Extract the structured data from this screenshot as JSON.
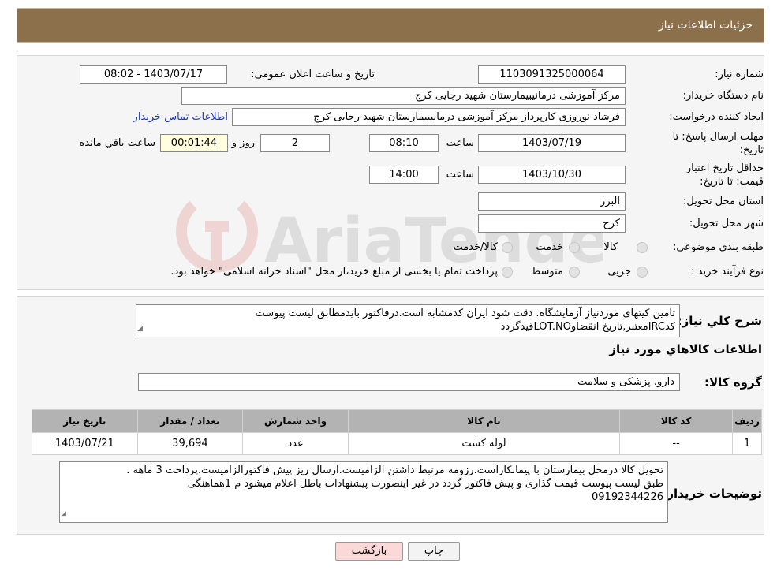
{
  "header": {
    "title": "جزئیات اطلاعات نیاز"
  },
  "form": {
    "need_number_label": "شماره نیاز:",
    "need_number": "1103091325000064",
    "announce_label": "تاریخ و ساعت اعلان عمومی:",
    "announce_value": "1403/07/17 - 08:02",
    "buyer_org_label": "نام دستگاه خریدار:",
    "buyer_org": "مرکز آموزشی درمانیبیمارستان شهید رجایی کرج",
    "creator_label": "ایجاد کننده درخواست:",
    "creator": "فرشاد نوروزی کارپرداز مرکز آموزشی درمانیبیمارستان شهید رجایی کرج",
    "contact_link": "اطلاعات تماس خریدار",
    "deadline_label": "مهلت ارسال پاسخ: تا تاریخ:",
    "deadline_date": "1403/07/19",
    "time_label": "ساعت",
    "deadline_time": "08:10",
    "days_value": "2",
    "days_label": "روز و",
    "remaining_time": "00:01:44",
    "remaining_label": "ساعت باقي مانده",
    "validity_label": "حداقل تاریخ اعتبار قیمت: تا تاریخ:",
    "validity_date": "1403/10/30",
    "validity_time": "14:00",
    "province_label": "استان محل تحویل:",
    "province": "البرز",
    "city_label": "شهر محل تحویل:",
    "city": "کرج",
    "category_label": "طبقه بندی موضوعی:",
    "category_options": [
      "کالا",
      "خدمت",
      "کالا/خدمت"
    ],
    "process_label": "نوع فرآیند خرید :",
    "process_options": [
      "جزیی",
      "متوسط"
    ],
    "payment_note": "پرداخت تمام یا بخشی از مبلغ خرید،از محل \"اسناد خزانه اسلامی\" خواهد بود."
  },
  "watermark_text": "AriaTender.neT",
  "description": {
    "label": "شرح کلي نياز:",
    "text_line1": "تامین کیتهای موردنیاز آزمایشگاه. دقت شود ایران کدمشابه است.درفاکتور بایدمطابق لیست پیوست",
    "text_line2": "کدIRCمعتبر,تاریخ انقضاوLOT.NOقیدگردد"
  },
  "goods": {
    "section_title": "اطلاعات کالاهاي مورد نياز",
    "group_label": "گروه کالا:",
    "group_value": "دارو، پزشکی و سلامت",
    "columns": [
      "ردیف",
      "کد کالا",
      "نام کالا",
      "واحد شمارش",
      "تعداد / مقدار",
      "تاریخ نیاز"
    ],
    "rows": [
      {
        "row": "1",
        "code": "--",
        "name": "لوله کشت",
        "unit": "عدد",
        "qty": "39,694",
        "date": "1403/07/21"
      }
    ]
  },
  "buyer_notes": {
    "label": "توضیحات خریدار:",
    "line1": "تحویل کالا درمحل بیمارستان با پیمانکاراست.رزومه مرتبط داشتن الزامیست.ارسال ریز پیش فاکتورالزامیست.پرداخت 3 ماهه .",
    "line2": "طبق لیست پیوست قیمت گذاری و پیش فاکتور گردد در غیر اینصورت پیشنهادات باطل اعلام میشود م 1هماهنگی",
    "line3": "09192344226"
  },
  "buttons": {
    "print": "چاپ",
    "back": "بازگشت"
  },
  "colors": {
    "header_bg": "#8c6f4b",
    "table_header": "#b3b3b3",
    "link": "#1a36c9",
    "back_button": "#fbd9d9"
  }
}
